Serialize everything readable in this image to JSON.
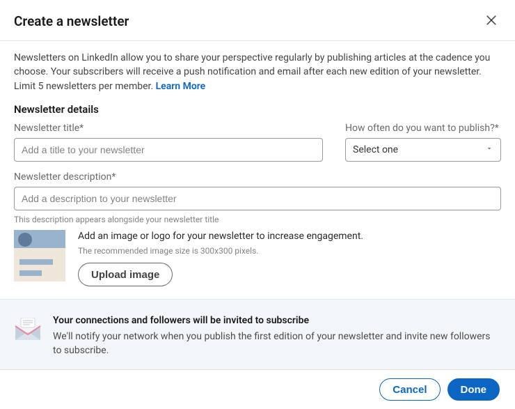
{
  "header": {
    "title": "Create a newsletter"
  },
  "intro": {
    "text": "Newsletters on LinkedIn allow you to share your perspective regularly by publishing articles at the cadence you choose. Your subscribers will receive a push notification and email after each new edition of your newsletter. Limit 5 newsletters per member. ",
    "learn_more": "Learn More"
  },
  "details": {
    "heading": "Newsletter details",
    "title_field": {
      "label": "Newsletter title*",
      "placeholder": "Add a title to your newsletter",
      "value": ""
    },
    "frequency_field": {
      "label": "How often do you want to publish?*",
      "selected": "Select one"
    },
    "description_field": {
      "label": "Newsletter description*",
      "placeholder": "Add a description to your newsletter",
      "value": "",
      "helper": "This description appears alongside your newsletter title"
    },
    "upload": {
      "title": "Add an image or logo for your newsletter to increase engagement.",
      "subtitle": "The recommended image size is 300x300 pixels.",
      "button": "Upload image"
    }
  },
  "notice": {
    "title": "Your connections and followers will be invited to subscribe",
    "body": "We'll notify your network when you publish the first edition of your newsletter and invite new followers to subscribe."
  },
  "footer": {
    "cancel": "Cancel",
    "done": "Done"
  }
}
